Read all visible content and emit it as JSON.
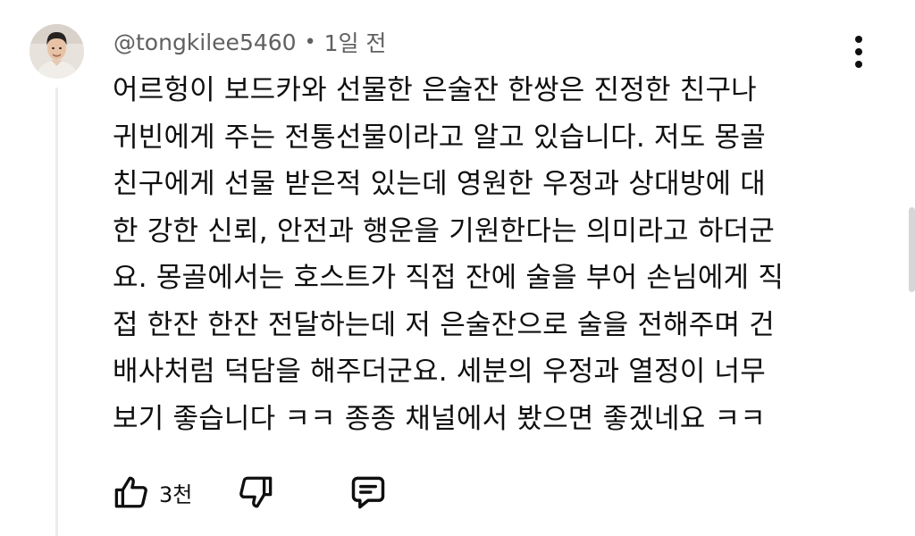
{
  "comment": {
    "author": "@tongkilee5460",
    "separator": "•",
    "time": "1일 전",
    "lines": [
      "어르헝이 보드카와 선물한 은술잔 한쌍은 진정한 친구나",
      "귀빈에게 주는 전통선물이라고 알고 있습니다. 저도 몽골",
      "친구에게 선물 받은적 있는데 영원한 우정과 상대방에 대",
      "한 강한 신뢰, 안전과 행운을 기원한다는 의미라고 하더군",
      "요. 몽골에서는 호스트가 직접 잔에 술을 부어 손님에게 직",
      "접 한잔 한잔 전달하는데 저 은술잔으로 술을 전해주며 건",
      "배사처럼 덕담을 해주더군요. 세분의 우정과 열정이 너무",
      "보기 좋습니다 ㅋㅋ 종종 채널에서 봤으면 좋겠네요 ㅋㅋ"
    ],
    "like_count": "3천"
  },
  "icons": {
    "more": "more-vert-icon",
    "like": "thumb-up-icon",
    "dislike": "thumb-down-icon",
    "reply": "reply-comment-icon"
  },
  "colors": {
    "text": "#0f0f0f",
    "meta": "#606060",
    "thread_line": "#ececec"
  }
}
